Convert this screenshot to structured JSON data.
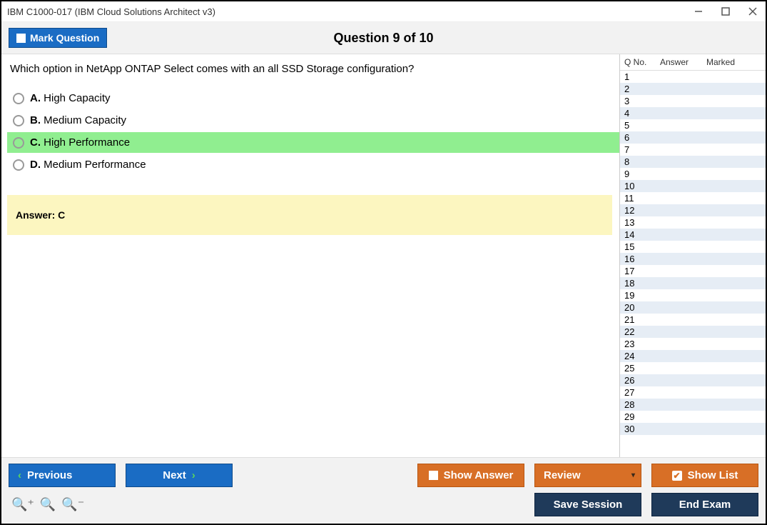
{
  "window": {
    "title": "IBM C1000-017 (IBM Cloud Solutions Architect v3)"
  },
  "header": {
    "mark_label": "Mark Question",
    "question_title": "Question 9 of 10"
  },
  "question": {
    "text": "Which option in NetApp ONTAP Select comes with an all SSD Storage configuration?",
    "options": [
      {
        "letter": "A.",
        "text": "High Capacity",
        "highlight": false
      },
      {
        "letter": "B.",
        "text": "Medium Capacity",
        "highlight": false
      },
      {
        "letter": "C.",
        "text": "High Performance",
        "highlight": true
      },
      {
        "letter": "D.",
        "text": "Medium Performance",
        "highlight": false
      }
    ],
    "answer_label": "Answer: C"
  },
  "sidebar": {
    "col_qno": "Q No.",
    "col_answer": "Answer",
    "col_marked": "Marked",
    "rows": [
      "1",
      "2",
      "3",
      "4",
      "5",
      "6",
      "7",
      "8",
      "9",
      "10",
      "11",
      "12",
      "13",
      "14",
      "15",
      "16",
      "17",
      "18",
      "19",
      "20",
      "21",
      "22",
      "23",
      "24",
      "25",
      "26",
      "27",
      "28",
      "29",
      "30"
    ]
  },
  "footer": {
    "previous": "Previous",
    "next": "Next",
    "show_answer": "Show Answer",
    "review": "Review",
    "show_list": "Show List",
    "save_session": "Save Session",
    "end_exam": "End Exam"
  }
}
